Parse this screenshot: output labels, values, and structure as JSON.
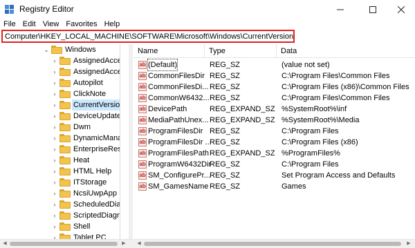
{
  "window": {
    "title": "Registry Editor",
    "icons": {
      "app": "registry-editor-icon",
      "minimize": "minimize-icon",
      "maximize": "maximize-icon",
      "close": "close-icon"
    }
  },
  "menu": [
    "File",
    "Edit",
    "View",
    "Favorites",
    "Help"
  ],
  "address": "Computer\\HKEY_LOCAL_MACHINE\\SOFTWARE\\Microsoft\\Windows\\CurrentVersion",
  "accent_colors": {
    "address_highlight": "#e0211d",
    "selected_row": "#cce8ff",
    "folder": "#f3c44d"
  },
  "tree": [
    {
      "label": "Windows",
      "expanded": true,
      "level": 0
    },
    {
      "label": "AssignedAcce",
      "level": 1
    },
    {
      "label": "AssignedAcce",
      "level": 1
    },
    {
      "label": "Autopilot",
      "level": 1
    },
    {
      "label": "ClickNote",
      "level": 1
    },
    {
      "label": "CurrentVersion",
      "level": 1,
      "selected": true
    },
    {
      "label": "DeviceUpdateC",
      "level": 1
    },
    {
      "label": "Dwm",
      "level": 1
    },
    {
      "label": "DynamicMana",
      "level": 1
    },
    {
      "label": "EnterpriseResc",
      "level": 1
    },
    {
      "label": "Heat",
      "level": 1
    },
    {
      "label": "HTML Help",
      "level": 1
    },
    {
      "label": "ITStorage",
      "level": 1
    },
    {
      "label": "NcsiUwpApp",
      "level": 1
    },
    {
      "label": "ScheduledDiag",
      "level": 1
    },
    {
      "label": "ScriptedDiagn",
      "level": 1
    },
    {
      "label": "Shell",
      "level": 1
    },
    {
      "label": "Tablet PC",
      "level": 1
    }
  ],
  "columns": [
    "Name",
    "Type",
    "Data"
  ],
  "values": [
    {
      "name": "(Default)",
      "type": "REG_SZ",
      "data": "(value not set)"
    },
    {
      "name": "CommonFilesDir",
      "type": "REG_SZ",
      "data": "C:\\Program Files\\Common Files"
    },
    {
      "name": "CommonFilesDi...",
      "type": "REG_SZ",
      "data": "C:\\Program Files (x86)\\Common Files"
    },
    {
      "name": "CommonW6432...",
      "type": "REG_SZ",
      "data": "C:\\Program Files\\Common Files"
    },
    {
      "name": "DevicePath",
      "type": "REG_EXPAND_SZ",
      "data": "%SystemRoot%\\inf"
    },
    {
      "name": "MediaPathUnex...",
      "type": "REG_EXPAND_SZ",
      "data": "%SystemRoot%\\Media"
    },
    {
      "name": "ProgramFilesDir",
      "type": "REG_SZ",
      "data": "C:\\Program Files"
    },
    {
      "name": "ProgramFilesDir ...",
      "type": "REG_SZ",
      "data": "C:\\Program Files (x86)"
    },
    {
      "name": "ProgramFilesPath",
      "type": "REG_EXPAND_SZ",
      "data": "%ProgramFiles%"
    },
    {
      "name": "ProgramW6432Dir",
      "type": "REG_SZ",
      "data": "C:\\Program Files"
    },
    {
      "name": "SM_ConfigurePr...",
      "type": "REG_SZ",
      "data": "Set Program Access and Defaults"
    },
    {
      "name": "SM_GamesName",
      "type": "REG_SZ",
      "data": "Games"
    }
  ],
  "value_icon_text": "ab"
}
